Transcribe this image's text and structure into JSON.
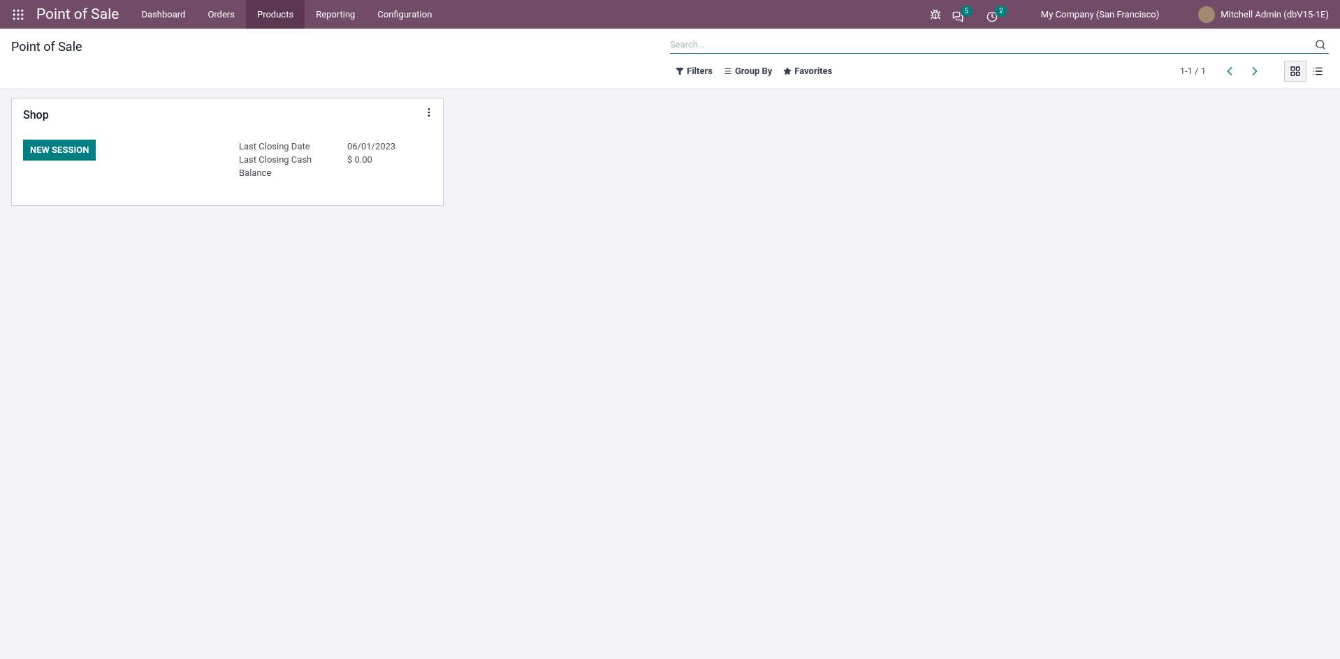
{
  "navbar": {
    "app_name": "Point of Sale",
    "menu": [
      {
        "label": "Dashboard",
        "selected": false
      },
      {
        "label": "Orders",
        "selected": false
      },
      {
        "label": "Products",
        "selected": true
      },
      {
        "label": "Reporting",
        "selected": false
      },
      {
        "label": "Configuration",
        "selected": false
      }
    ],
    "messages_badge": "5",
    "activities_badge": "2",
    "company": "My Company (San Francisco)",
    "user": "Mitchell Admin (dbV15-1E)"
  },
  "control_panel": {
    "title": "Point of Sale",
    "search": {
      "placeholder": "Search..."
    },
    "filters": [
      {
        "kind": "filter",
        "label": "Filters"
      },
      {
        "kind": "groupby",
        "label": "Group By"
      },
      {
        "kind": "favorites",
        "label": "Favorites"
      }
    ],
    "pager": "1-1 / 1",
    "views": [
      {
        "kind": "kanban",
        "selected": true
      },
      {
        "kind": "list",
        "selected": false
      }
    ]
  },
  "cards": [
    {
      "title": "Shop",
      "button": "NEW SESSION",
      "fields": [
        {
          "label": "Last Closing Date",
          "value": "06/01/2023"
        },
        {
          "label": "Last Closing Cash Balance",
          "value": "$ 0.00"
        }
      ]
    }
  ]
}
